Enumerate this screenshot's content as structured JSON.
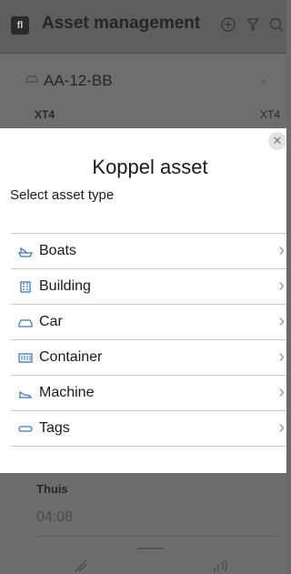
{
  "background": {
    "app_logo": "fl",
    "title": "Asset management",
    "header_icons": [
      "add-circle-icon",
      "filter-icon",
      "search-icon"
    ],
    "asset_row": {
      "plate": "AA-12-BB",
      "left_label": "XT4",
      "right_label": "XT4",
      "icon": "car-icon"
    },
    "bottom": {
      "location": "Thuis",
      "time": "04:08"
    },
    "bottom_nav_icons": [
      "link-icon",
      "signal-icon"
    ]
  },
  "modal": {
    "title": "Koppel asset",
    "subtitle": "Select asset type",
    "close_icon": "close-icon",
    "items": [
      {
        "label": "Boats",
        "icon": "boat-icon"
      },
      {
        "label": "Building",
        "icon": "building-icon"
      },
      {
        "label": "Car",
        "icon": "car-icon"
      },
      {
        "label": "Container",
        "icon": "container-icon"
      },
      {
        "label": "Machine",
        "icon": "machine-icon"
      },
      {
        "label": "Tags",
        "icon": "tag-icon"
      }
    ]
  },
  "colors": {
    "accent": "#3f76b3",
    "overlay": "#6b6b6b",
    "sheet": "#ffffff"
  }
}
